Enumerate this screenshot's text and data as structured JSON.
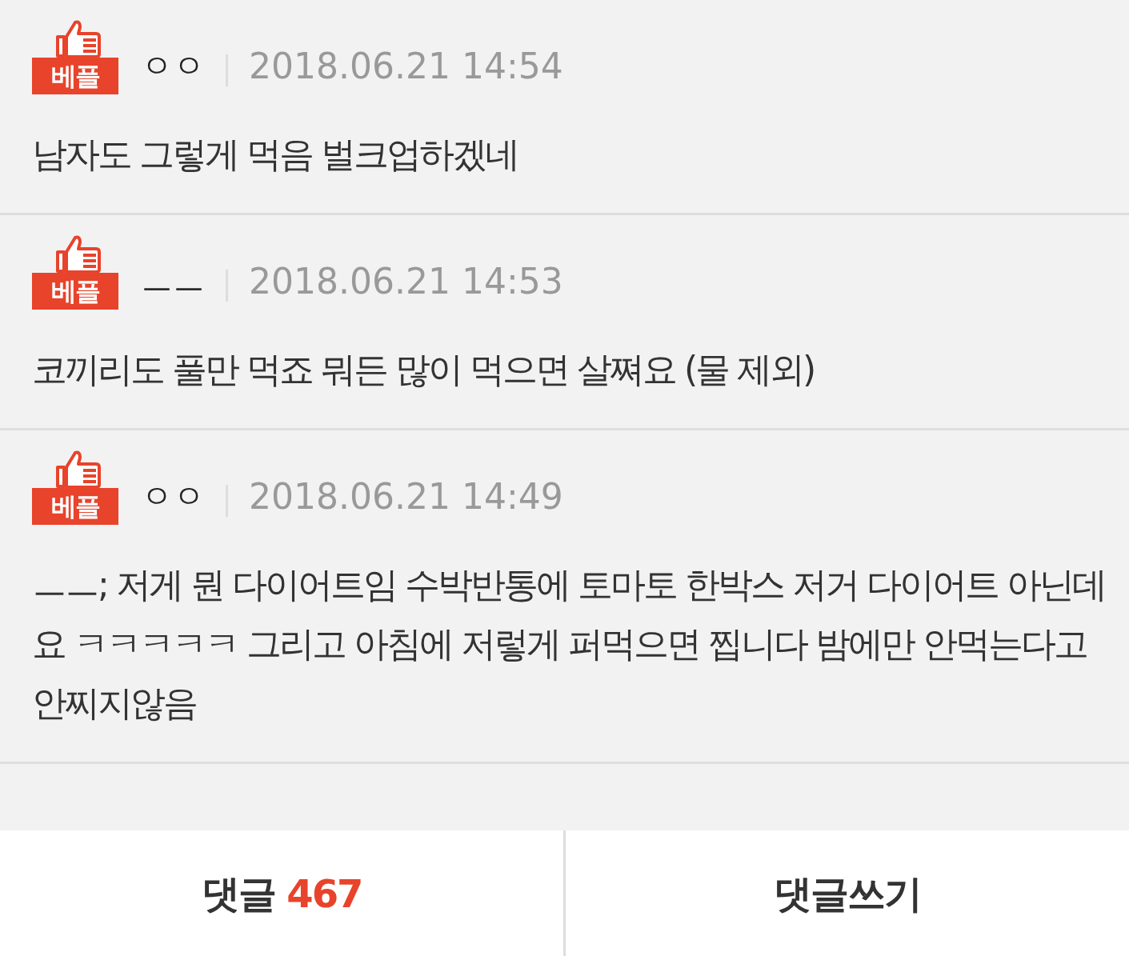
{
  "comments": [
    {
      "badge": "베플",
      "author": "ㅇㅇ",
      "time": "2018.06.21 14:54",
      "text": "남자도 그렇게 먹음 벌크업하겠네"
    },
    {
      "badge": "베플",
      "author": "ㅡㅡ",
      "time": "2018.06.21 14:53",
      "text": "코끼리도 풀만 먹죠 뭐든 많이 먹으면 살쪄요 (물 제외)"
    },
    {
      "badge": "베플",
      "author": "ㅇㅇ",
      "time": "2018.06.21 14:49",
      "text": "ㅡㅡ; 저게 뭔 다이어트임 수박반통에 토마토 한박스 저거 다이어트 아닌데요 ㅋㅋㅋㅋㅋ 그리고 아침에 저렇게 퍼먹으면 찝니다 밤에만 안먹는다고 안찌지않음"
    }
  ],
  "footer": {
    "comments_label": "댓글",
    "comments_count": "467",
    "write_label": "댓글쓰기"
  }
}
